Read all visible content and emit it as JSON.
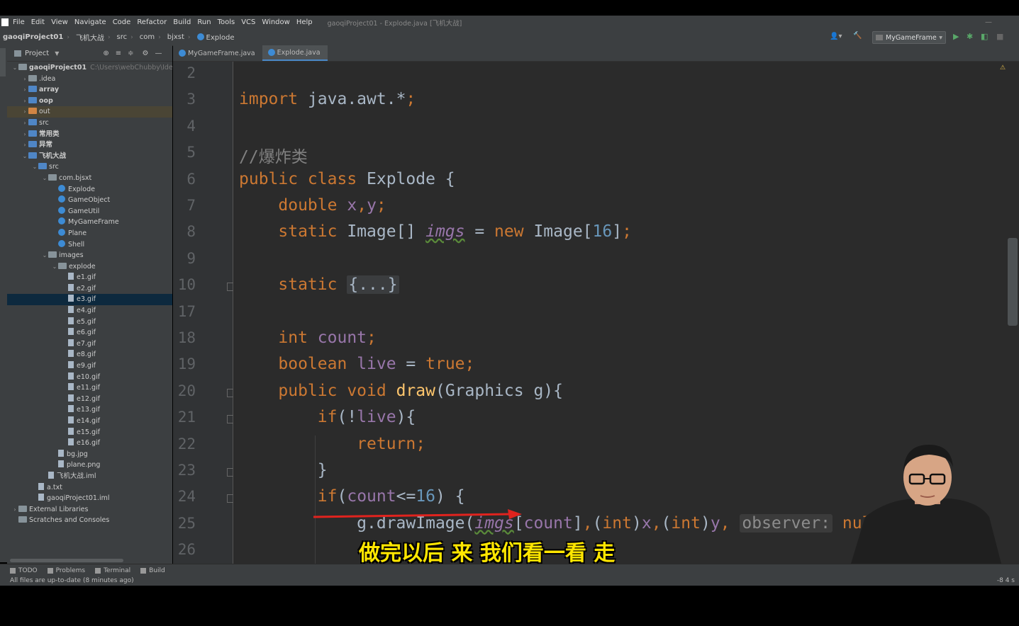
{
  "menu": {
    "items": [
      "File",
      "Edit",
      "View",
      "Navigate",
      "Code",
      "Refactor",
      "Build",
      "Run",
      "Tools",
      "VCS",
      "Window",
      "Help"
    ],
    "title": "gaoqiProject01 - Explode.java [飞机大战]"
  },
  "breadcrumbs": [
    "gaoqiProject01",
    "飞机大战",
    "src",
    "com",
    "bjxst",
    "Explode"
  ],
  "run_config": "MyGameFrame",
  "project_panel": {
    "title": "Project",
    "rows": [
      {
        "depth": 0,
        "arrow": "⌄",
        "icon": "fold",
        "label": "gaoqiProject01",
        "extra": "C:\\Users\\webChubby\\IdeaP",
        "bold": true
      },
      {
        "depth": 1,
        "arrow": "›",
        "icon": "fold",
        "label": ".idea"
      },
      {
        "depth": 1,
        "arrow": "›",
        "icon": "fold blue",
        "label": "array",
        "bold": true
      },
      {
        "depth": 1,
        "arrow": "›",
        "icon": "fold blue",
        "label": "oop",
        "bold": true
      },
      {
        "depth": 1,
        "arrow": "›",
        "icon": "fold orange",
        "label": "out",
        "hl": true
      },
      {
        "depth": 1,
        "arrow": "›",
        "icon": "fold blue",
        "label": "src"
      },
      {
        "depth": 1,
        "arrow": "›",
        "icon": "fold blue",
        "label": "常用类",
        "bold": true
      },
      {
        "depth": 1,
        "arrow": "›",
        "icon": "fold blue",
        "label": "异常",
        "bold": true
      },
      {
        "depth": 1,
        "arrow": "⌄",
        "icon": "fold blue",
        "label": "飞机大战",
        "bold": true
      },
      {
        "depth": 2,
        "arrow": "⌄",
        "icon": "fold blue",
        "label": "src"
      },
      {
        "depth": 3,
        "arrow": "⌄",
        "icon": "fold",
        "label": "com.bjsxt"
      },
      {
        "depth": 4,
        "arrow": "",
        "icon": "cls",
        "label": "Explode"
      },
      {
        "depth": 4,
        "arrow": "",
        "icon": "cls",
        "label": "GameObject"
      },
      {
        "depth": 4,
        "arrow": "",
        "icon": "cls",
        "label": "GameUtil"
      },
      {
        "depth": 4,
        "arrow": "",
        "icon": "cls",
        "label": "MyGameFrame"
      },
      {
        "depth": 4,
        "arrow": "",
        "icon": "cls",
        "label": "Plane"
      },
      {
        "depth": 4,
        "arrow": "",
        "icon": "cls",
        "label": "Shell"
      },
      {
        "depth": 3,
        "arrow": "⌄",
        "icon": "fold",
        "label": "images"
      },
      {
        "depth": 4,
        "arrow": "⌄",
        "icon": "fold",
        "label": "explode"
      },
      {
        "depth": 5,
        "arrow": "",
        "icon": "file",
        "label": "e1.gif"
      },
      {
        "depth": 5,
        "arrow": "",
        "icon": "file",
        "label": "e2.gif"
      },
      {
        "depth": 5,
        "arrow": "",
        "icon": "file",
        "label": "e3.gif",
        "sel": true
      },
      {
        "depth": 5,
        "arrow": "",
        "icon": "file",
        "label": "e4.gif"
      },
      {
        "depth": 5,
        "arrow": "",
        "icon": "file",
        "label": "e5.gif"
      },
      {
        "depth": 5,
        "arrow": "",
        "icon": "file",
        "label": "e6.gif"
      },
      {
        "depth": 5,
        "arrow": "",
        "icon": "file",
        "label": "e7.gif"
      },
      {
        "depth": 5,
        "arrow": "",
        "icon": "file",
        "label": "e8.gif"
      },
      {
        "depth": 5,
        "arrow": "",
        "icon": "file",
        "label": "e9.gif"
      },
      {
        "depth": 5,
        "arrow": "",
        "icon": "file",
        "label": "e10.gif"
      },
      {
        "depth": 5,
        "arrow": "",
        "icon": "file",
        "label": "e11.gif"
      },
      {
        "depth": 5,
        "arrow": "",
        "icon": "file",
        "label": "e12.gif"
      },
      {
        "depth": 5,
        "arrow": "",
        "icon": "file",
        "label": "e13.gif"
      },
      {
        "depth": 5,
        "arrow": "",
        "icon": "file",
        "label": "e14.gif"
      },
      {
        "depth": 5,
        "arrow": "",
        "icon": "file",
        "label": "e15.gif"
      },
      {
        "depth": 5,
        "arrow": "",
        "icon": "file",
        "label": "e16.gif"
      },
      {
        "depth": 4,
        "arrow": "",
        "icon": "file",
        "label": "bg.jpg"
      },
      {
        "depth": 4,
        "arrow": "",
        "icon": "file",
        "label": "plane.png"
      },
      {
        "depth": 3,
        "arrow": "",
        "icon": "file",
        "label": "飞机大战.iml"
      },
      {
        "depth": 2,
        "arrow": "",
        "icon": "file",
        "label": "a.txt"
      },
      {
        "depth": 2,
        "arrow": "",
        "icon": "file",
        "label": "gaoqiProject01.iml"
      },
      {
        "depth": 0,
        "arrow": "›",
        "icon": "fold",
        "label": "External Libraries"
      },
      {
        "depth": 0,
        "arrow": "",
        "icon": "fold",
        "label": "Scratches and Consoles"
      }
    ]
  },
  "tabs": [
    {
      "label": "MyGameFrame.java",
      "active": false
    },
    {
      "label": "Explode.java",
      "active": true
    }
  ],
  "warnings": "2",
  "code_lines": [
    {
      "n": "2",
      "html": ""
    },
    {
      "n": "3",
      "html": "<span class='kw'>import</span> java.awt.*<span class='kw'>;</span>"
    },
    {
      "n": "4",
      "html": ""
    },
    {
      "n": "5",
      "html": "<span class='cm'>//爆炸类</span>"
    },
    {
      "n": "6",
      "html": "<span class='kw'>public class</span> Explode {"
    },
    {
      "n": "7",
      "html": "    <span class='kw'>double</span> <span class='fld'>x</span><span class='kw'>,</span><span class='fld'>y</span><span class='kw'>;</span>"
    },
    {
      "n": "8",
      "html": "    <span class='kw'>static</span> Image[] <span class='fld ital'>imgs</span> = <span class='kw'>new</span> Image[<span class='num'>16</span>]<span class='kw'>;</span>"
    },
    {
      "n": "9",
      "html": ""
    },
    {
      "n": "10",
      "html": "    <span class='kw'>static</span> <span class='collapsed'>{...}</span>",
      "fold": true
    },
    {
      "n": "17",
      "html": ""
    },
    {
      "n": "18",
      "html": "    <span class='kw'>int</span> <span class='fld'>count</span><span class='kw'>;</span>"
    },
    {
      "n": "19",
      "html": "    <span class='kw'>boolean</span> <span class='fld'>live</span> = <span class='kw'>true;</span>"
    },
    {
      "n": "20",
      "html": "    <span class='kw'>public void</span> <span style='color:#ffc66d'>draw</span>(Graphics g){",
      "fold": true
    },
    {
      "n": "21",
      "html": "        <span class='kw'>if</span>(!<span class='fld'>live</span>){",
      "fold": true
    },
    {
      "n": "22",
      "html": "            <span class='kw'>return;</span>"
    },
    {
      "n": "23",
      "html": "        }",
      "fold": true
    },
    {
      "n": "24",
      "html": "        <span class='kw'>if</span>(<span class='fld'>count</span>&lt;=<span class='num'>16</span>) {",
      "fold": true
    },
    {
      "n": "25",
      "html": "            g.drawImage(<span class='fld ital'>imgs</span>[<span class='fld'>count</span>]<span class='kw'>,</span>(<span class='kw'>int</span>)<span class='fld'>x</span><span class='kw'>,</span>(<span class='kw'>int</span>)<span class='fld'>y</span><span class='kw'>,</span> <span class='hint'>observer:</span> <span class='kw'>null</span>)<span class='kw'>;</span>"
    },
    {
      "n": "26",
      "html": ""
    }
  ],
  "bottom_tools": [
    "TODO",
    "Problems",
    "Terminal",
    "Build"
  ],
  "status": "All files are up-to-date (8 minutes ago)",
  "status_right": "-8   4 s",
  "subtitle": "做完以后 来 我们看一看 走"
}
